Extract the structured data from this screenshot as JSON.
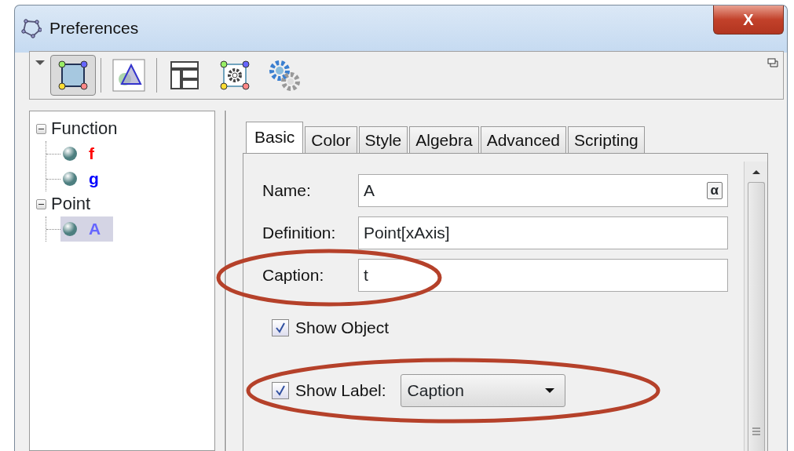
{
  "window": {
    "title": "Preferences",
    "close": "X"
  },
  "toolbar": [
    {
      "kind": "object",
      "selected": true
    },
    {
      "kind": "graphics",
      "selected": false
    },
    {
      "kind": "layout",
      "selected": false
    },
    {
      "kind": "defaults",
      "selected": false
    },
    {
      "kind": "advanced",
      "selected": false
    }
  ],
  "tree": [
    {
      "label": "Function",
      "expanded": true,
      "children": [
        {
          "label": "f",
          "color": "#ff0000",
          "selected": false
        },
        {
          "label": "g",
          "color": "#0000ff",
          "selected": false
        }
      ]
    },
    {
      "label": "Point",
      "expanded": true,
      "children": [
        {
          "label": "A",
          "color": "#6666ff",
          "selected": true
        }
      ]
    }
  ],
  "tabs": [
    {
      "label": "Basic",
      "selected": true
    },
    {
      "label": "Color",
      "selected": false
    },
    {
      "label": "Style",
      "selected": false
    },
    {
      "label": "Algebra",
      "selected": false
    },
    {
      "label": "Advanced",
      "selected": false
    },
    {
      "label": "Scripting",
      "selected": false
    }
  ],
  "fields": [
    {
      "label": "Name:",
      "value": "A",
      "symbol": "α",
      "highlighted": false
    },
    {
      "label": "Definition:",
      "value": "Point[xAxis]",
      "highlighted": false
    },
    {
      "label": "Caption:",
      "value": "t",
      "highlighted": true
    }
  ],
  "checks": [
    {
      "label": "Show Object",
      "checked": true,
      "highlighted": false
    },
    {
      "label": "Show Label:",
      "checked": true,
      "dropdown": "Caption",
      "highlighted": true
    }
  ]
}
